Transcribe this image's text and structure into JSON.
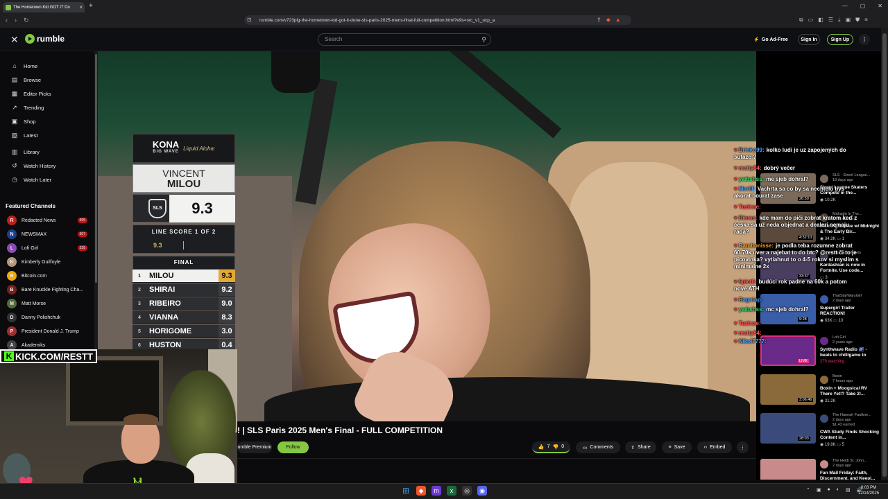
{
  "browser": {
    "tab_title": "The Hometown Kid GOT IT Do",
    "url": "rumble.com/v723plg-the-hometown-kid-got-it-done-sls-paris-2025-mens-final-full-competition.html?e9s=src_v1_ucp_a"
  },
  "header": {
    "logo": "rumble",
    "search_placeholder": "Search",
    "go_ad_free": "Go Ad-Free",
    "sign_in": "Sign In",
    "sign_up": "Sign Up"
  },
  "sidebar": {
    "nav": [
      {
        "label": "Home",
        "icon": "home-icon"
      },
      {
        "label": "Browse",
        "icon": "browse-icon"
      },
      {
        "label": "Editor Picks",
        "icon": "editor-picks-icon"
      },
      {
        "label": "Trending",
        "icon": "trending-icon"
      },
      {
        "label": "Shop",
        "icon": "shop-icon"
      },
      {
        "label": "Latest",
        "icon": "latest-icon"
      },
      {
        "label": "Library",
        "icon": "library-icon"
      },
      {
        "label": "Watch History",
        "icon": "history-icon"
      },
      {
        "label": "Watch Later",
        "icon": "clock-icon"
      }
    ],
    "featured_title": "Featured Channels",
    "channels": [
      {
        "name": "Redacted News",
        "count": "595",
        "color": "#c21d1d",
        "letter": "R"
      },
      {
        "name": "NEWSMAX",
        "count": "507",
        "color": "#1c3f8f",
        "letter": "N"
      },
      {
        "name": "Lofi Girl",
        "count": "318",
        "color": "#8a4bb2",
        "letter": "L"
      },
      {
        "name": "Kimberly Guilfoyle",
        "count": "",
        "color": "#b8977a",
        "letter": "K"
      },
      {
        "name": "Bitcoin.com",
        "count": "",
        "color": "#f2a900",
        "letter": "B"
      },
      {
        "name": "Bare Knuckle Fighting Cha...",
        "count": "",
        "color": "#7a1e1e",
        "letter": "B"
      },
      {
        "name": "Matt Morse",
        "count": "",
        "color": "#556b3a",
        "letter": "M"
      },
      {
        "name": "Danny Polishchuk",
        "count": "",
        "color": "#333333",
        "letter": "D"
      },
      {
        "name": "President Donald J. Trump",
        "count": "",
        "color": "#a03030",
        "letter": "P"
      },
      {
        "name": "Akademiks",
        "count": "",
        "color": "#444444",
        "letter": "A"
      }
    ]
  },
  "scoreboard": {
    "brand_main": "KONA",
    "brand_sub": "BIG WAVE",
    "brand_tagline": "Liquid Aloha:",
    "first_name": "VINCENT",
    "last_name": "MILOU",
    "league": "SLS",
    "score": "9.3",
    "line_score_label": "LINE SCORE 1 OF 2",
    "line_score_value": "9.3",
    "final_label": "FINAL",
    "standings": [
      {
        "rank": "1",
        "name": "MILOU",
        "score": "9.3"
      },
      {
        "rank": "2",
        "name": "SHIRAI",
        "score": "9.2"
      },
      {
        "rank": "3",
        "name": "RIBEIRO",
        "score": "9.0"
      },
      {
        "rank": "4",
        "name": "VIANNA",
        "score": "8.3"
      },
      {
        "rank": "5",
        "name": "HORIGOME",
        "score": "3.0"
      },
      {
        "rank": "6",
        "name": "HUSTON",
        "score": "0.4"
      }
    ]
  },
  "video": {
    "title": "! | SLS Paris 2025 Men's Final - FULL COMPETITION",
    "premium_label": "umble Premium",
    "follow": "Follow",
    "likes": "7",
    "dislikes": "0",
    "comments": "Comments",
    "share": "Share",
    "save": "Save",
    "embed": "Embed"
  },
  "stream_overlay": {
    "kick_url": "KICK.COM/RESTT"
  },
  "chat": [
    {
      "user": "Brinko99:",
      "text": "kolko ludi je uz zapojených do sutaze ?",
      "color": "#4aa3ff"
    },
    {
      "user": "matty84:",
      "text": "dobrý večer",
      "color": "#ff5a5a"
    },
    {
      "user": "ywbshss:",
      "text": "me sjeb dohral?",
      "color": "#3fdc6c"
    },
    {
      "user": "Mcrilf:",
      "text": "Vachrta sa co by sa nechtelo bys akorat bourat zase",
      "color": "#4aa3ff"
    },
    {
      "user": "Tuzinae:",
      "text": "",
      "color": "#ff5a5a"
    },
    {
      "user": "Dimas:",
      "text": "kde mam do piči zobrat kratom keď z česka sa už neda objednat a dealeri nemaju rada?",
      "color": "#ff5a5a"
    },
    {
      "user": "Rambonisse:",
      "text": "je podla teba rozumne zobrat 60-70k uver a najebat to do btc? @restt či to je picovinka? vytiahnut to o 4-5 rokov si myslím s minimalne 2x",
      "color": "#ff9f2a"
    },
    {
      "user": "6pict6:",
      "text": "budúci rok padne na 60k a potom nové ATH",
      "color": "#ff5a5a"
    },
    {
      "user": "Ragniop:",
      "text": "",
      "color": "#4aa3ff"
    },
    {
      "user": "ywbshss:",
      "text": "mc sjeb dohral?",
      "color": "#3fdc6c"
    },
    {
      "user": "Tuzinae:",
      "text": "",
      "color": "#ff5a5a"
    },
    {
      "user": "matty84:",
      "text": "",
      "color": "#ff5a5a"
    },
    {
      "user": "Nikol7777:",
      "text": "",
      "color": "#4aa3ff"
    }
  ],
  "related": [
    {
      "channel": "SLS - Street League...",
      "age": "18 days ago",
      "title": "Street League Skaters Compete in the...",
      "views": "10.2K",
      "comments": "",
      "duration": "26:50",
      "thumb": "#7b6a5a"
    },
    {
      "channel": "Midnight In The...",
      "age": "19 hours ago",
      "title": "Morning Coffee w/ Midnight & The Early Bir...",
      "views": "34.2K",
      "comments": "1",
      "duration": "4:52:13",
      "thumb": "#5b4a3c"
    },
    {
      "channel": "Stampede/Pixels",
      "age": "",
      "title": "Kardashian is now in Fortnite. Use code...",
      "views": "",
      "comments": "3",
      "duration": "33:37",
      "thumb": "#4a3e60"
    },
    {
      "channel": "ThatStarWarsGirl",
      "age": "2 days ago",
      "title": "Supergirl Trailer REACTION!",
      "views": "63K",
      "comments": "10",
      "duration": "9:28",
      "thumb": "#3a5da8"
    },
    {
      "channel": "Lofi Girl",
      "age": "2 years ago",
      "title": "Synthwave Radio 🌌 - beats to chill/game to",
      "views": "270 watching",
      "comments": "",
      "duration": "LIVE",
      "thumb": "#6a2a8a"
    },
    {
      "channel": "Boxin",
      "age": "7 hours ago",
      "title": "Boxin + Moogsical RV There Yet!? Take 2!...",
      "views": "31.2K",
      "comments": "",
      "duration": "3:06:46",
      "thumb": "#8a6a3a"
    },
    {
      "channel": "The Hannah Faulkne...",
      "age": "2 days ago",
      "title": "CWA Study Finds Shocking Content in...",
      "views": "19.8K",
      "comments": "5",
      "duration": "28:03",
      "thumb": "#3a4a7a",
      "earned": "$1.43 earned"
    },
    {
      "channel": "The Heidi St. John...",
      "age": "2 days ago",
      "title": "Fan Mail Friday: Faith, Discernment, and Keepi...",
      "views": "",
      "comments": "",
      "duration": "",
      "thumb": "#c88a8a"
    }
  ],
  "taskbar": {
    "time": "8:03 PM",
    "date": "12/14/2025"
  }
}
